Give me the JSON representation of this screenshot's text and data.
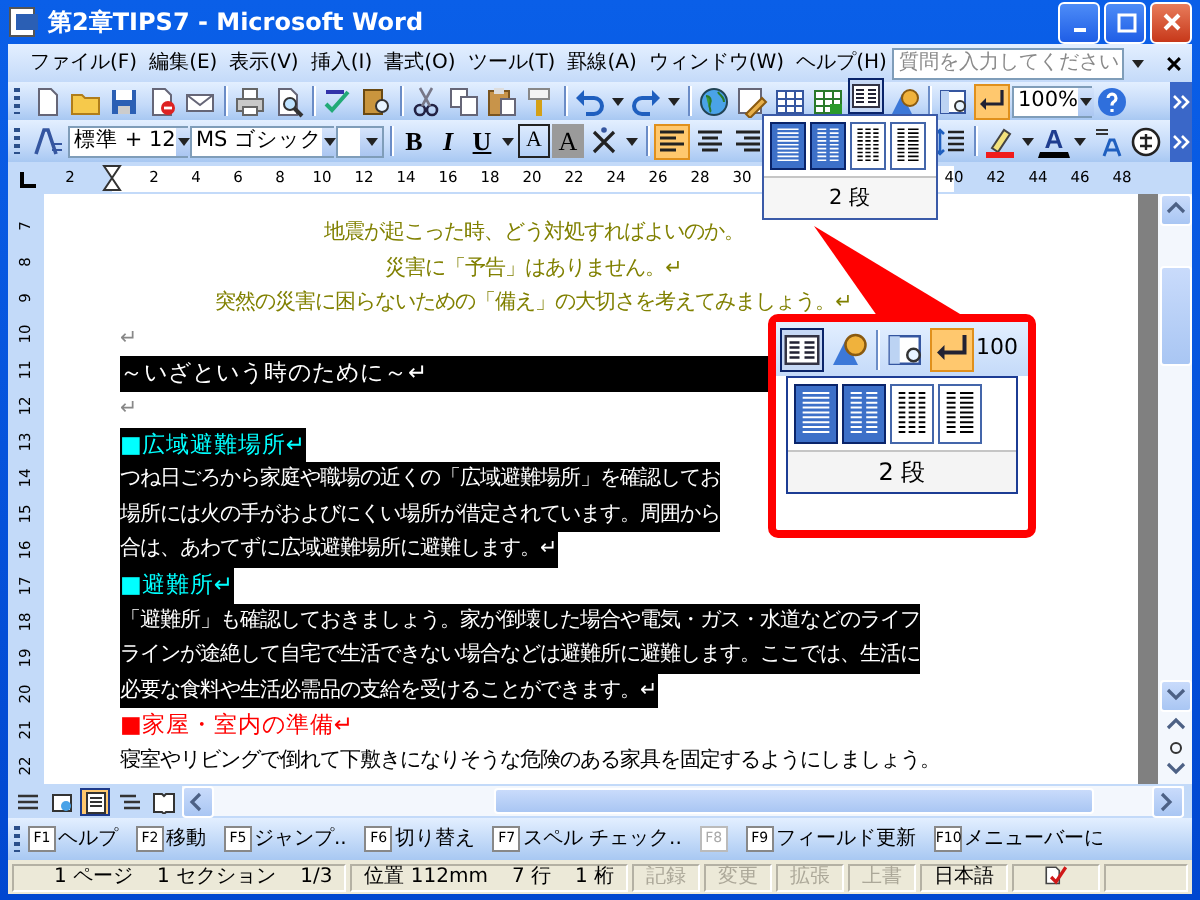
{
  "window": {
    "title": "第2章TIPS7 - Microsoft Word"
  },
  "menu_bar": {
    "items": [
      "ファイル(F)",
      "編集(E)",
      "表示(V)",
      "挿入(I)",
      "書式(O)",
      "ツール(T)",
      "罫線(A)",
      "ウィンドウ(W)",
      "ヘルプ(H)"
    ],
    "help_box": {
      "placeholder": "質問を入力してください"
    }
  },
  "standard_toolbar": {
    "columns_pressed": true,
    "show_marks_pressed": true,
    "zoom": "100%"
  },
  "formatting_toolbar": {
    "style": "標準 + 12",
    "font": "MS ゴシック",
    "letter_buttons": [
      "B",
      "I",
      "U",
      "A",
      "A"
    ],
    "align_left_pressed": true,
    "font_color_letter": "A"
  },
  "columns_dropdown": {
    "options": [
      {
        "selected": true
      },
      {
        "selected": true
      },
      {
        "selected": false
      },
      {
        "selected": false
      }
    ],
    "label": "2 段"
  },
  "ruler": {
    "left_numbers": [
      "2"
    ],
    "numbers": [
      "2",
      "4",
      "6",
      "8",
      "10",
      "12",
      "14",
      "16",
      "18",
      "20",
      "22",
      "24",
      "26",
      "28",
      "30"
    ],
    "right_numbers": [
      "40",
      "42",
      "44",
      "46",
      "48"
    ],
    "side_numbers": [
      "7",
      "8",
      "9",
      "10",
      "11",
      "12",
      "13",
      "14",
      "15",
      "16",
      "17",
      "18",
      "19",
      "20",
      "21",
      "22"
    ]
  },
  "document": {
    "lines": [
      {
        "kind": "title",
        "text": "地震が起こった時、どう対処すればよいのか。",
        "selected": false
      },
      {
        "kind": "title",
        "text": "災害に「予告」はありません。↵",
        "selected": false
      },
      {
        "kind": "title",
        "text": "突然の災害に困らないための「備え」の大切さを考えてみましょう。↵",
        "selected": false
      },
      {
        "kind": "body",
        "text": "↵",
        "selected": false
      },
      {
        "kind": "banner",
        "text": "～いざという時のために～↵",
        "selected": false
      },
      {
        "kind": "body",
        "text": "↵",
        "selected": false
      },
      {
        "kind": "heading",
        "text": "■広域避難場所↵",
        "selected": true
      },
      {
        "kind": "body",
        "text": "つね日ごろから家庭や職場の近くの「広域避難場所」を確認してお",
        "selected": true
      },
      {
        "kind": "body",
        "text": "場所には火の手がおよびにくい場所が借定されています。周囲から",
        "selected": true
      },
      {
        "kind": "body",
        "text": "合は、あわてずに広域避難場所に避難します。↵",
        "selected": true
      },
      {
        "kind": "heading",
        "text": "■避難所↵",
        "selected": true
      },
      {
        "kind": "body",
        "text": "「避難所」も確認しておきましょう。家が倒壊した場合や電気・ガス・水道などのライフ",
        "selected": true
      },
      {
        "kind": "body",
        "text": "ラインが途絶して自宅で生活できない場合などは避難所に避難します。ここでは、生活に",
        "selected": true
      },
      {
        "kind": "body",
        "text": "必要な食料や生活必需品の支給を受けることができます。↵",
        "selected": true
      },
      {
        "kind": "heading",
        "text": "■家屋・室内の準備↵",
        "selected": false
      },
      {
        "kind": "body",
        "text": "寝室やリビングで倒れて下敷きになりそうな危険のある家具を固定するようにしましょう。",
        "selected": false
      }
    ]
  },
  "callout": {
    "columns_pressed": true,
    "show_marks_pressed": true,
    "zoom_fragment": "100",
    "options": [
      {
        "selected": true
      },
      {
        "selected": true
      },
      {
        "selected": false
      },
      {
        "selected": false
      }
    ],
    "label": "2 段"
  },
  "view_buttons": [
    {
      "selected": false
    },
    {
      "selected": false
    },
    {
      "selected": true
    },
    {
      "selected": false
    },
    {
      "selected": false
    }
  ],
  "function_keys": [
    {
      "key": "F1",
      "label": "ヘルプ",
      "disabled": false
    },
    {
      "key": "F2",
      "label": "移動",
      "disabled": false
    },
    {
      "key": "F5",
      "label": "ジャンプ..",
      "disabled": false
    },
    {
      "key": "F6",
      "label": "切り替え",
      "disabled": false
    },
    {
      "key": "F7",
      "label": "スペル チェック..",
      "disabled": false
    },
    {
      "key": "F8",
      "disabled": true
    },
    {
      "key": "F9",
      "label": "フィールド更新",
      "disabled": false
    },
    {
      "key": "F10",
      "label": "メニューバーに",
      "disabled": false
    }
  ],
  "status_bar": {
    "panels": [
      {
        "kind": "text",
        "texts": [
          "1 ページ",
          "1 セクション",
          "1/3"
        ],
        "disabled": false
      },
      {
        "kind": "text",
        "texts": [
          "位置 112mm",
          "7 行",
          "1 桁"
        ],
        "disabled": false
      },
      {
        "kind": "text",
        "texts": [
          "記録"
        ],
        "disabled": true
      },
      {
        "kind": "text",
        "texts": [
          "変更"
        ],
        "disabled": true
      },
      {
        "kind": "text",
        "texts": [
          "拡張"
        ],
        "disabled": true
      },
      {
        "kind": "text",
        "texts": [
          "上書"
        ],
        "disabled": true
      },
      {
        "kind": "text",
        "texts": [
          "日本語"
        ],
        "disabled": false
      },
      {
        "kind": "icon",
        "disabled": false
      }
    ]
  }
}
